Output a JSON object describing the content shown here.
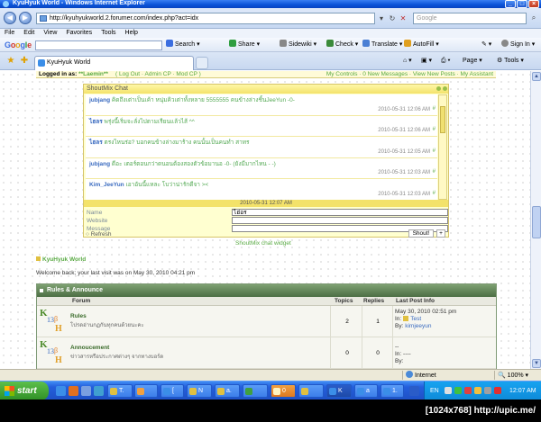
{
  "window": {
    "title": "KyuHyuk World - Windows Internet Explorer",
    "min": "_",
    "max": "□",
    "close": "×"
  },
  "address": {
    "url": "http://kyuhyukworld.2.forumer.com/index.php?act=idx",
    "search_placeholder": "Google"
  },
  "menu": [
    "File",
    "Edit",
    "View",
    "Favorites",
    "Tools",
    "Help"
  ],
  "google": {
    "logo": [
      "G",
      "o",
      "o",
      "g",
      "l",
      "e"
    ],
    "items": [
      {
        "label": "Search",
        "icon": "search-icon"
      },
      {
        "label": "Share",
        "icon": "share-icon"
      },
      {
        "label": "Sidewiki",
        "icon": "sidewiki-icon"
      },
      {
        "label": "Check",
        "icon": "check-icon"
      },
      {
        "label": "Translate",
        "icon": "translate-icon"
      },
      {
        "label": "AutoFill",
        "icon": "autofill-icon"
      },
      {
        "label": "Sign In",
        "icon": "user-icon"
      }
    ]
  },
  "tab": {
    "label": "KyuHyuk World"
  },
  "toolbar_right": {
    "page": "Page",
    "tools": "Tools"
  },
  "logged": {
    "label": "Logged in as: ",
    "user": "**Laemin**",
    "links": "( Log Out · Admin CP · Mod CP )",
    "right_links": "My Controls · 0 New Messages · View New Posts · My Assistant"
  },
  "shoutmix": {
    "title": "ShoutMix Chat",
    "messages": [
      {
        "name": "jubjang",
        "text": "คิดถึงเต่าเป็นเค้า หนุ่มคิวเต่าทั้งหลาย 5555555 คนข้างล่างชิ้นJeeYun -0-",
        "time": "2010-05-31 12:06 AM"
      },
      {
        "name": "ไฮลร",
        "text": "พรุ่งนี้เริ่มจะลั่งไปตามเรียนแล้วไส้ ^^",
        "time": "2010-05-31 12:06 AM"
      },
      {
        "name": "ไฮลร",
        "text": "ตรงไหนร่อ? บอกคนข้างล่างมาร้าง คนนั้นเป็นคนทำ สาทร",
        "time": "2010-05-31 12:05 AM"
      },
      {
        "name": "jubjang",
        "text": "ดีอะ เตอร์ตอนกว่าดนอนต้องสองตัวข้อมานอ -0- (ยังมีมากไหน - -)",
        "time": "2010-05-31 12:03 AM"
      },
      {
        "name": "Kim_JeeYun",
        "text": "เอาอันนี้แหละ โบว่าน่ารักดีจา ><",
        "time": "2010-05-31 12:03 AM"
      }
    ],
    "last_time": "2010-05-31 12:07 AM",
    "name_label": "Name",
    "name_value": "ไฮ่อร",
    "website_label": "Website",
    "message_label": "Message",
    "refresh": "Refresh",
    "shout_btn": "Shout!",
    "plus_btn": "+",
    "widget_link": "ShoutMix chat widget"
  },
  "page": {
    "site_link": "KyuHyuk World",
    "welcome": "Welcome back; your last visit was on May 30, 2010 04:21 pm"
  },
  "forum": {
    "category": "Rules & Announce",
    "headers": {
      "forum": "Forum",
      "topics": "Topics",
      "replies": "Replies",
      "last": "Last Post Info"
    },
    "rows": [
      {
        "title": "Rules",
        "desc": "โปรดอ่านกฏกันทุกคนด้วยนะคะ",
        "topics": "2",
        "replies": "1",
        "last_date": "May 30, 2010 02:51 pm",
        "in_label": "In:",
        "in_topic": "Test",
        "by_label": "By:",
        "by_user": "kimjeeyun"
      },
      {
        "title": "Annoucement",
        "desc": "ข่าวสารหรือประกาศต่างๆ จากทางบอร์ด",
        "topics": "0",
        "replies": "0",
        "last_date": "--",
        "in_label": "In:",
        "in_topic": "----",
        "by_label": "By:",
        "by_user": ""
      }
    ],
    "logo_parts": {
      "k": "K",
      "n": "13",
      "b": "β",
      "h": "H"
    }
  },
  "status": {
    "zone": "Internet",
    "zoom": "100%"
  },
  "taskbar": {
    "start": "start",
    "tasks": [
      "T.",
      "[",
      "N",
      "a.",
      "0",
      "K",
      "a",
      "1."
    ],
    "lang": "EN",
    "clock": "12:07 AM"
  },
  "caption": "[1024x768] http://upic.me/"
}
